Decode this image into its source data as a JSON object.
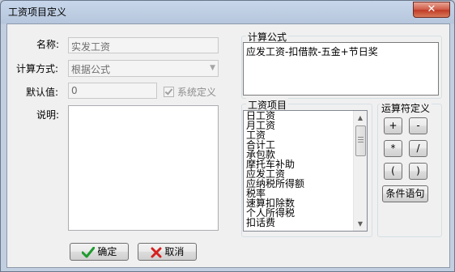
{
  "window": {
    "title": "工资项目定义",
    "close_glyph": "✕"
  },
  "form": {
    "name_label": "名称:",
    "name_value": "实发工资",
    "calc_label": "计算方式:",
    "calc_value": "根据公式",
    "default_label": "默认值:",
    "default_value": "0",
    "system_defined_label": "系统定义",
    "system_defined_checked": true,
    "desc_label": "说明:",
    "desc_value": ""
  },
  "formula": {
    "label": "计算公式",
    "value": "应发工资-扣借款-五金+节日奖"
  },
  "items": {
    "label": "工资项目",
    "list": [
      "日工资",
      "月工资",
      "工资",
      "合计工",
      "承包款",
      "摩托车补助",
      "应发工资",
      "应纳税所得额",
      "税率",
      "速算扣除数",
      "个人所得税",
      "扣话费"
    ]
  },
  "operators": {
    "label": "运算符定义",
    "buttons": [
      "+",
      "-",
      "*",
      "/",
      "(",
      ")"
    ],
    "condition_label": "条件语句"
  },
  "actions": {
    "ok_label": "确定",
    "cancel_label": "取消",
    "ok_icon": "green-checkmark-icon",
    "cancel_icon": "red-x-icon"
  },
  "colors": {
    "ok_icon": "#1e9b2e",
    "cancel_icon": "#d42020",
    "close_button": "#c7412c"
  }
}
